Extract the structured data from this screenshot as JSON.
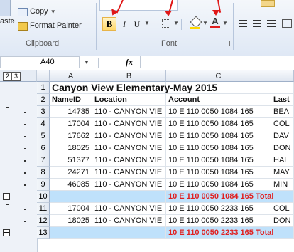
{
  "ribbon": {
    "copy_label": "Copy",
    "paste_label": "aste",
    "format_painter_label": "Format Painter",
    "clipboard_label": "Clipboard",
    "font_label": "Font",
    "bold_glyph": "B",
    "italic_glyph": "I",
    "underline_glyph": "U",
    "font_color_glyph": "A",
    "accent_color": "#e02020"
  },
  "formula_bar": {
    "name_box": "A40",
    "fx": "fx",
    "value": ""
  },
  "outline_levels": [
    "2",
    "3"
  ],
  "columns": [
    "A",
    "B",
    "C"
  ],
  "rows": [
    {
      "num": "1",
      "a": "Canyon View Elementary-May 2015",
      "b": "",
      "c": "",
      "d": "",
      "type": "title"
    },
    {
      "num": "2",
      "a": "NameID",
      "b": "Location",
      "c": "Account",
      "d": "Last",
      "type": "header"
    },
    {
      "num": "3",
      "a": "14735",
      "b": "110 - CANYON VIE",
      "c": "10 E 110 0050 1084 165",
      "d": "BEA",
      "type": "data"
    },
    {
      "num": "4",
      "a": "17004",
      "b": "110 - CANYON VIE",
      "c": "10 E 110 0050 1084 165",
      "d": "COL",
      "type": "data"
    },
    {
      "num": "5",
      "a": "17662",
      "b": "110 - CANYON VIE",
      "c": "10 E 110 0050 1084 165",
      "d": "DAV",
      "type": "data"
    },
    {
      "num": "6",
      "a": "18025",
      "b": "110 - CANYON VIE",
      "c": "10 E 110 0050 1084 165",
      "d": "DON",
      "type": "data"
    },
    {
      "num": "7",
      "a": "51377",
      "b": "110 - CANYON VIE",
      "c": "10 E 110 0050 1084 165",
      "d": "HAL",
      "type": "data"
    },
    {
      "num": "8",
      "a": "24271",
      "b": "110 - CANYON VIE",
      "c": "10 E 110 0050 1084 165",
      "d": "MAY",
      "type": "data"
    },
    {
      "num": "9",
      "a": "46085",
      "b": "110 - CANYON VIE",
      "c": "10 E 110 0050 1084 165",
      "d": "MIN",
      "type": "data"
    },
    {
      "num": "10",
      "a": "",
      "b": "",
      "c": "10 E 110 0050 1084 165 Total",
      "d": "",
      "type": "total"
    },
    {
      "num": "11",
      "a": "17004",
      "b": "110 - CANYON VIE",
      "c": "10 E 110 0050 2233 165",
      "d": "COL",
      "type": "data"
    },
    {
      "num": "12",
      "a": "18025",
      "b": "110 - CANYON VIE",
      "c": "10 E 110 0050 2233 165",
      "d": "DON",
      "type": "data"
    },
    {
      "num": "13",
      "a": "",
      "b": "",
      "c": "10 E 110 0050 2233 165 Total",
      "d": "",
      "type": "total"
    }
  ]
}
